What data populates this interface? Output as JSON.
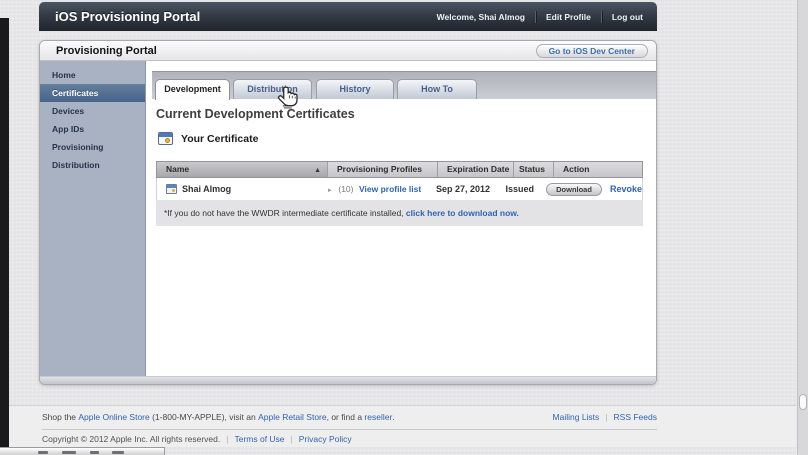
{
  "topnav": {
    "title": "iOS Provisioning Portal",
    "welcome": "Welcome, Shai Almog",
    "edit_profile": "Edit Profile",
    "log_out": "Log out"
  },
  "portal_bar": {
    "title": "Provisioning Portal",
    "dev_center_button": "Go to iOS Dev Center"
  },
  "sidebar": {
    "items": [
      {
        "label": "Home",
        "selected": false
      },
      {
        "label": "Certificates",
        "selected": true
      },
      {
        "label": "Devices",
        "selected": false
      },
      {
        "label": "App IDs",
        "selected": false
      },
      {
        "label": "Provisioning",
        "selected": false
      },
      {
        "label": "Distribution",
        "selected": false
      }
    ]
  },
  "tabs": [
    {
      "label": "Development",
      "active": true
    },
    {
      "label": "Distribution",
      "active": false
    },
    {
      "label": "History",
      "active": false
    },
    {
      "label": "How To",
      "active": false
    }
  ],
  "content": {
    "heading": "Current Development Certificates",
    "section_title": "Your Certificate"
  },
  "table": {
    "columns": [
      "Name",
      "Provisioning Profiles",
      "Expiration Date",
      "Status",
      "Action"
    ],
    "sort_icon": "▲",
    "row": {
      "name": "Shai Almog",
      "profiles_disclosure": "►",
      "profiles_count": "(10)",
      "profiles_link": "View profile list",
      "expiration_date": "Sep 27, 2012",
      "status": "Issued",
      "download_button": "Download",
      "revoke_link": "Revoke"
    }
  },
  "note": {
    "text": "*If you do not have the WWDR intermediate certificate installed, ",
    "link": "click here to download now."
  },
  "footer": {
    "shop_prefix": "Shop the ",
    "online_store_link": "Apple Online Store",
    "shop_mid": " (1-800-MY-APPLE), visit an ",
    "retail_store_link": "Apple Retail Store",
    "shop_mid2": ", or find a ",
    "reseller_link": "reseller",
    "shop_suffix": ".",
    "mailing_lists_link": "Mailing Lists",
    "links_separator": "|",
    "rss_feeds_link": "RSS Feeds",
    "copyright": "Copyright © 2012 Apple Inc. All rights reserved.",
    "terms_link": "Terms of Use",
    "privacy_link": "Privacy Policy"
  },
  "colors": {
    "accent_blue": "#3064ad",
    "navbar_dark": "#23272f",
    "sidebar_bg": "#a9b2c2",
    "selected_item_blue": "#47628d",
    "note_band_gray": "#e3e3e5"
  }
}
